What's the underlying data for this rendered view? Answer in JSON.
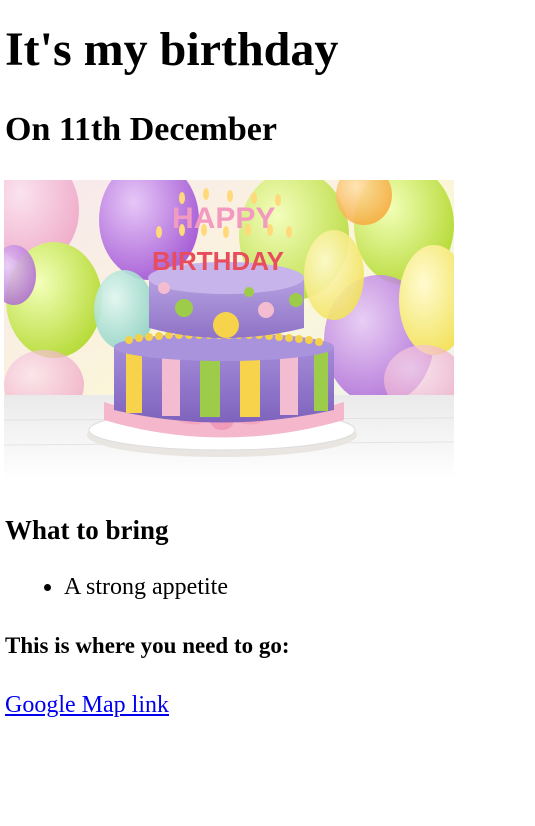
{
  "title": "It's my birthday",
  "subtitle": "On 11th December",
  "image": {
    "cake_text_line1": "HAPPY",
    "cake_text_line2": "BIRTHDAY"
  },
  "bring": {
    "heading": "What to bring",
    "items": [
      "A strong appetite"
    ]
  },
  "directions": {
    "heading": "This is where you need to go:",
    "link_text": "Google Map link"
  },
  "colors": {
    "link": "#0000ee",
    "cake_purple": "#9b7fd0",
    "cake_pink": "#f4b8cc",
    "cake_yellow": "#f5d24a",
    "cake_green": "#9ccc4a"
  }
}
